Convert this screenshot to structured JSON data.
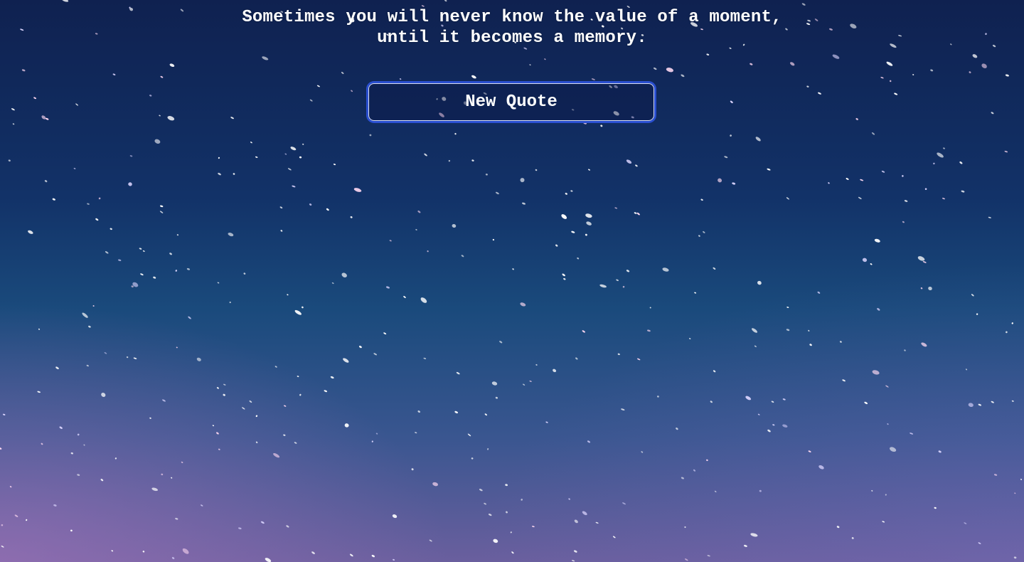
{
  "quote": {
    "text": "Sometimes you will never know the value of a moment,\nuntil it becomes a memory."
  },
  "button": {
    "label": "New Quote"
  },
  "colors": {
    "text": "#ffffff",
    "button_focus_ring": "#2a4fd0",
    "sky_top": "#0f2150",
    "sky_bottom": "#6a5f9e"
  }
}
